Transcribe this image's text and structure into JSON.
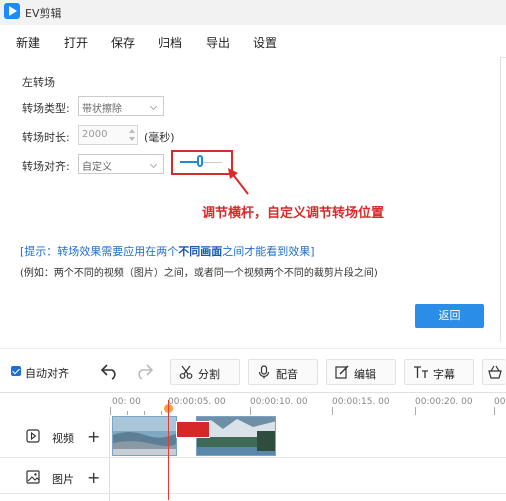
{
  "app": {
    "title": "EV剪辑"
  },
  "menu": [
    "新建",
    "打开",
    "保存",
    "归档",
    "导出",
    "设置"
  ],
  "dialog": {
    "section_title": "左转场",
    "type_label": "转场类型:",
    "type_value": "带状擦除",
    "duration_label": "转场时长:",
    "duration_value": "2000",
    "duration_unit": "(毫秒)",
    "align_label": "转场对齐:",
    "align_value": "自定义",
    "slider_value": 0.45,
    "annotation": "调节横杆，自定义调节转场位置",
    "hint_prefix": "[提示：转场效果需要应用在两个",
    "hint_strong": "不同画面",
    "hint_suffix": "之间才能看到效果]",
    "example": "(例如：两个不同的视频（图片）之间，或者同一个视频两个不同的裁剪片段之间)",
    "back_label": "返回"
  },
  "toolbar": {
    "auto_align_label": "自动对齐",
    "auto_align_checked": true,
    "split_label": "分割",
    "dub_label": "配音",
    "edit_label": "编辑",
    "subtitle_label": "字幕"
  },
  "timeline": {
    "ruler_labels": [
      "00: 00",
      "00:00:05. 00",
      "00:00:10. 00",
      "00:00:15. 00",
      "00:00:20. 00",
      "00:"
    ],
    "tracks": [
      {
        "label": "视频"
      },
      {
        "label": "图片"
      }
    ]
  },
  "colors": {
    "accent": "#2a8de8",
    "annotation": "#d92b2b",
    "playhead": "#e53935"
  }
}
